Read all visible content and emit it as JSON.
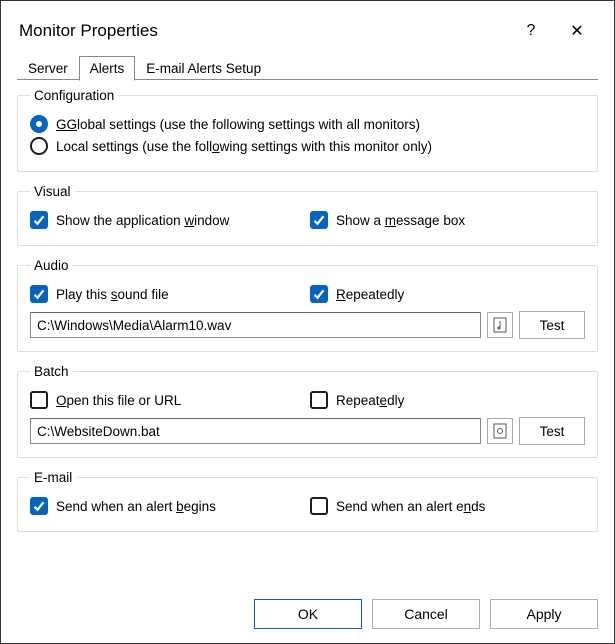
{
  "window": {
    "title": "Monitor Properties",
    "help_icon": "?",
    "close_icon": "✕"
  },
  "tabs": {
    "server": "Server",
    "alerts": "Alerts",
    "email_setup": "E-mail Alerts Setup"
  },
  "configuration": {
    "legend": "Configuration",
    "global_label": "Global settings (use the following settings with all monitors)",
    "local_label": "Local settings (use the following settings with this monitor only)"
  },
  "visual": {
    "legend": "Visual",
    "show_app_window": "Show the application window",
    "show_msg_box": "Show a message box"
  },
  "audio": {
    "legend": "Audio",
    "play_sound": "Play this sound file",
    "repeatedly": "Repeatedly",
    "path": "C:\\Windows\\Media\\Alarm10.wav",
    "test": "Test"
  },
  "batch": {
    "legend": "Batch",
    "open_file": "Open this file or URL",
    "repeatedly": "Repeatedly",
    "path": "C:\\WebsiteDown.bat",
    "test": "Test"
  },
  "email": {
    "legend": "E-mail",
    "send_begin": "Send when an alert begins",
    "send_end": "Send when an alert ends"
  },
  "footer": {
    "ok": "OK",
    "cancel": "Cancel",
    "apply": "Apply"
  }
}
